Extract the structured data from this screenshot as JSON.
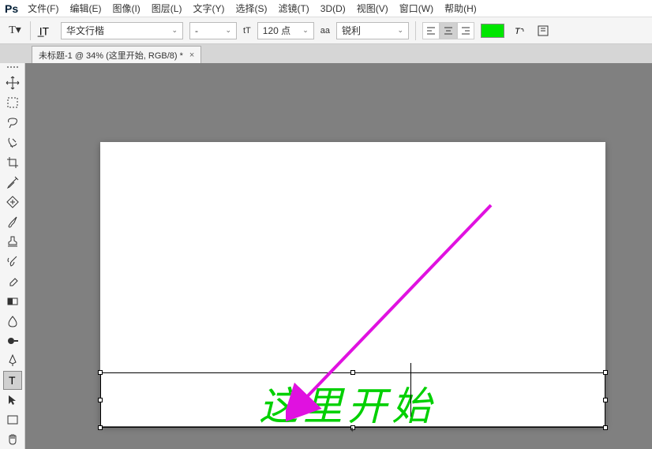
{
  "menu": {
    "items": [
      "文件(F)",
      "编辑(E)",
      "图像(I)",
      "图层(L)",
      "文字(Y)",
      "选择(S)",
      "滤镜(T)",
      "3D(D)",
      "视图(V)",
      "窗口(W)",
      "帮助(H)"
    ]
  },
  "optbar": {
    "font_family": "华文行楷",
    "font_size": "120 点",
    "aa_mode": "锐利",
    "tt_label": "tT",
    "aa_label": "aa",
    "text_color": "#00E600"
  },
  "tab": {
    "label": "未标题-1 @ 34% (这里开始, RGB/8) *"
  },
  "canvas": {
    "typed_text": "这里开始"
  }
}
